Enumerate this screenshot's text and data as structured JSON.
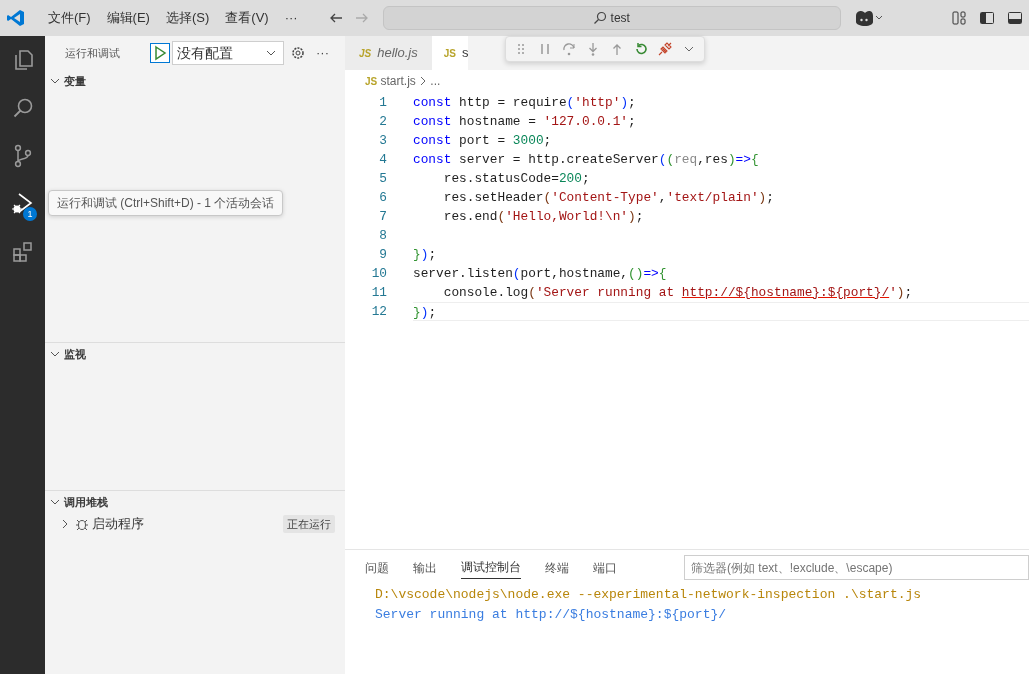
{
  "title_bar": {
    "menus": [
      "文件(F)",
      "编辑(E)",
      "选择(S)",
      "查看(V)",
      "···"
    ],
    "search": {
      "value": "test"
    }
  },
  "activity_bar": {
    "items": [
      {
        "kind": "files",
        "selected": false
      },
      {
        "kind": "search",
        "selected": false
      },
      {
        "kind": "source-control",
        "selected": false
      },
      {
        "kind": "run-debug",
        "selected": true,
        "badge": "1"
      },
      {
        "kind": "extensions",
        "selected": false
      }
    ],
    "tooltip": "运行和调试 (Ctrl+Shift+D) - 1 个活动会话"
  },
  "sidebar": {
    "title": "运行和调试",
    "config": "没有配置",
    "more": "···",
    "sections": [
      {
        "title": "变量",
        "expanded": true
      },
      {
        "title": "监视",
        "expanded": true
      },
      {
        "title": "调用堆栈",
        "expanded": true,
        "items": [
          {
            "label": "启动程序",
            "status": "正在运行",
            "expanded": false
          }
        ]
      }
    ]
  },
  "editor": {
    "tabs": [
      {
        "icon": "JS",
        "label": "hello.js",
        "selected": false
      },
      {
        "icon": "JS",
        "label": "s",
        "selected": true
      }
    ],
    "breadcrumb": {
      "icon": "JS",
      "file": "start.js",
      "rest": "..."
    },
    "lines": [
      {
        "number": "1",
        "tokens": [
          {
            "text": "const",
            "kind": "kw"
          },
          {
            "text": " http = require",
            "kind": "id"
          },
          {
            "text": "(",
            "kind": "b1"
          },
          {
            "text": "'http'",
            "kind": "str"
          },
          {
            "text": ")",
            "kind": "b1"
          },
          {
            "text": ";",
            "kind": "id"
          }
        ]
      },
      {
        "number": "2",
        "tokens": [
          {
            "text": "const",
            "kind": "kw"
          },
          {
            "text": " hostname = ",
            "kind": "id"
          },
          {
            "text": "'127.0.0.1'",
            "kind": "str"
          },
          {
            "text": ";",
            "kind": "id"
          }
        ]
      },
      {
        "number": "3",
        "tokens": [
          {
            "text": "const",
            "kind": "kw"
          },
          {
            "text": " port = ",
            "kind": "id"
          },
          {
            "text": "3000",
            "kind": "num"
          },
          {
            "text": ";",
            "kind": "id"
          }
        ]
      },
      {
        "number": "4",
        "tokens": [
          {
            "text": "const",
            "kind": "kw"
          },
          {
            "text": " server = http.createServer",
            "kind": "id"
          },
          {
            "text": "(",
            "kind": "b1"
          },
          {
            "text": "(",
            "kind": "b2"
          },
          {
            "text": "req",
            "kind": "dim"
          },
          {
            "text": ",res",
            "kind": "id"
          },
          {
            "text": ")",
            "kind": "b2"
          },
          {
            "text": "=>",
            "kind": "kw"
          },
          {
            "text": "{",
            "kind": "b2"
          }
        ]
      },
      {
        "number": "5",
        "tokens": [
          {
            "text": "    res.statusCode=",
            "kind": "id"
          },
          {
            "text": "200",
            "kind": "num"
          },
          {
            "text": ";",
            "kind": "id"
          }
        ]
      },
      {
        "number": "6",
        "tokens": [
          {
            "text": "    res.setHeader",
            "kind": "id"
          },
          {
            "text": "(",
            "kind": "b3"
          },
          {
            "text": "'Content-Type'",
            "kind": "str"
          },
          {
            "text": ",",
            "kind": "id"
          },
          {
            "text": "'text/plain'",
            "kind": "str"
          },
          {
            "text": ")",
            "kind": "b3"
          },
          {
            "text": ";",
            "kind": "id"
          }
        ]
      },
      {
        "number": "7",
        "tokens": [
          {
            "text": "    res.end",
            "kind": "id"
          },
          {
            "text": "(",
            "kind": "b3"
          },
          {
            "text": "'Hello,World!\\n'",
            "kind": "str"
          },
          {
            "text": ")",
            "kind": "b3"
          },
          {
            "text": ";",
            "kind": "id"
          }
        ]
      },
      {
        "number": "8"
      },
      {
        "number": "9",
        "tokens": [
          {
            "text": "}",
            "kind": "b2"
          },
          {
            "text": ")",
            "kind": "b1"
          },
          {
            "text": ";",
            "kind": "id"
          }
        ]
      },
      {
        "number": "10",
        "tokens": [
          {
            "text": "server.listen",
            "kind": "id"
          },
          {
            "text": "(",
            "kind": "b1"
          },
          {
            "text": "port,hostname,",
            "kind": "id"
          },
          {
            "text": "(",
            "kind": "b2"
          },
          {
            "text": ")",
            "kind": "b2"
          },
          {
            "text": "=>",
            "kind": "kw"
          },
          {
            "text": "{",
            "kind": "b2"
          }
        ]
      },
      {
        "number": "11",
        "tokens": [
          {
            "text": "    console.log",
            "kind": "id"
          },
          {
            "text": "(",
            "kind": "b3"
          },
          {
            "text": "'Server running at ",
            "kind": "str"
          },
          {
            "text": "http://${hostname}:${port}/",
            "kind": "err"
          },
          {
            "text": "'",
            "kind": "str"
          },
          {
            "text": ")",
            "kind": "b3"
          },
          {
            "text": ";",
            "kind": "id"
          }
        ]
      },
      {
        "number": "12",
        "current": true,
        "tokens": [
          {
            "text": "}",
            "kind": "b2"
          },
          {
            "text": ")",
            "kind": "b1"
          },
          {
            "text": ";",
            "kind": "id"
          }
        ]
      }
    ]
  },
  "panel": {
    "tabs": [
      {
        "label": "问题",
        "selected": false
      },
      {
        "label": "输出",
        "selected": false
      },
      {
        "label": "调试控制台",
        "selected": true
      },
      {
        "label": "终端",
        "selected": false
      },
      {
        "label": "端口",
        "selected": false
      }
    ],
    "filter": {
      "placeholder": "筛选器(例如 text、!exclude、\\escape)"
    },
    "output": [
      {
        "kind": "command",
        "text": "D:\\vscode\\nodejs\\node.exe --experimental-network-inspection .\\start.js"
      },
      {
        "kind": "log",
        "text": "Server running at http://${hostname}:${port}/"
      }
    ]
  }
}
